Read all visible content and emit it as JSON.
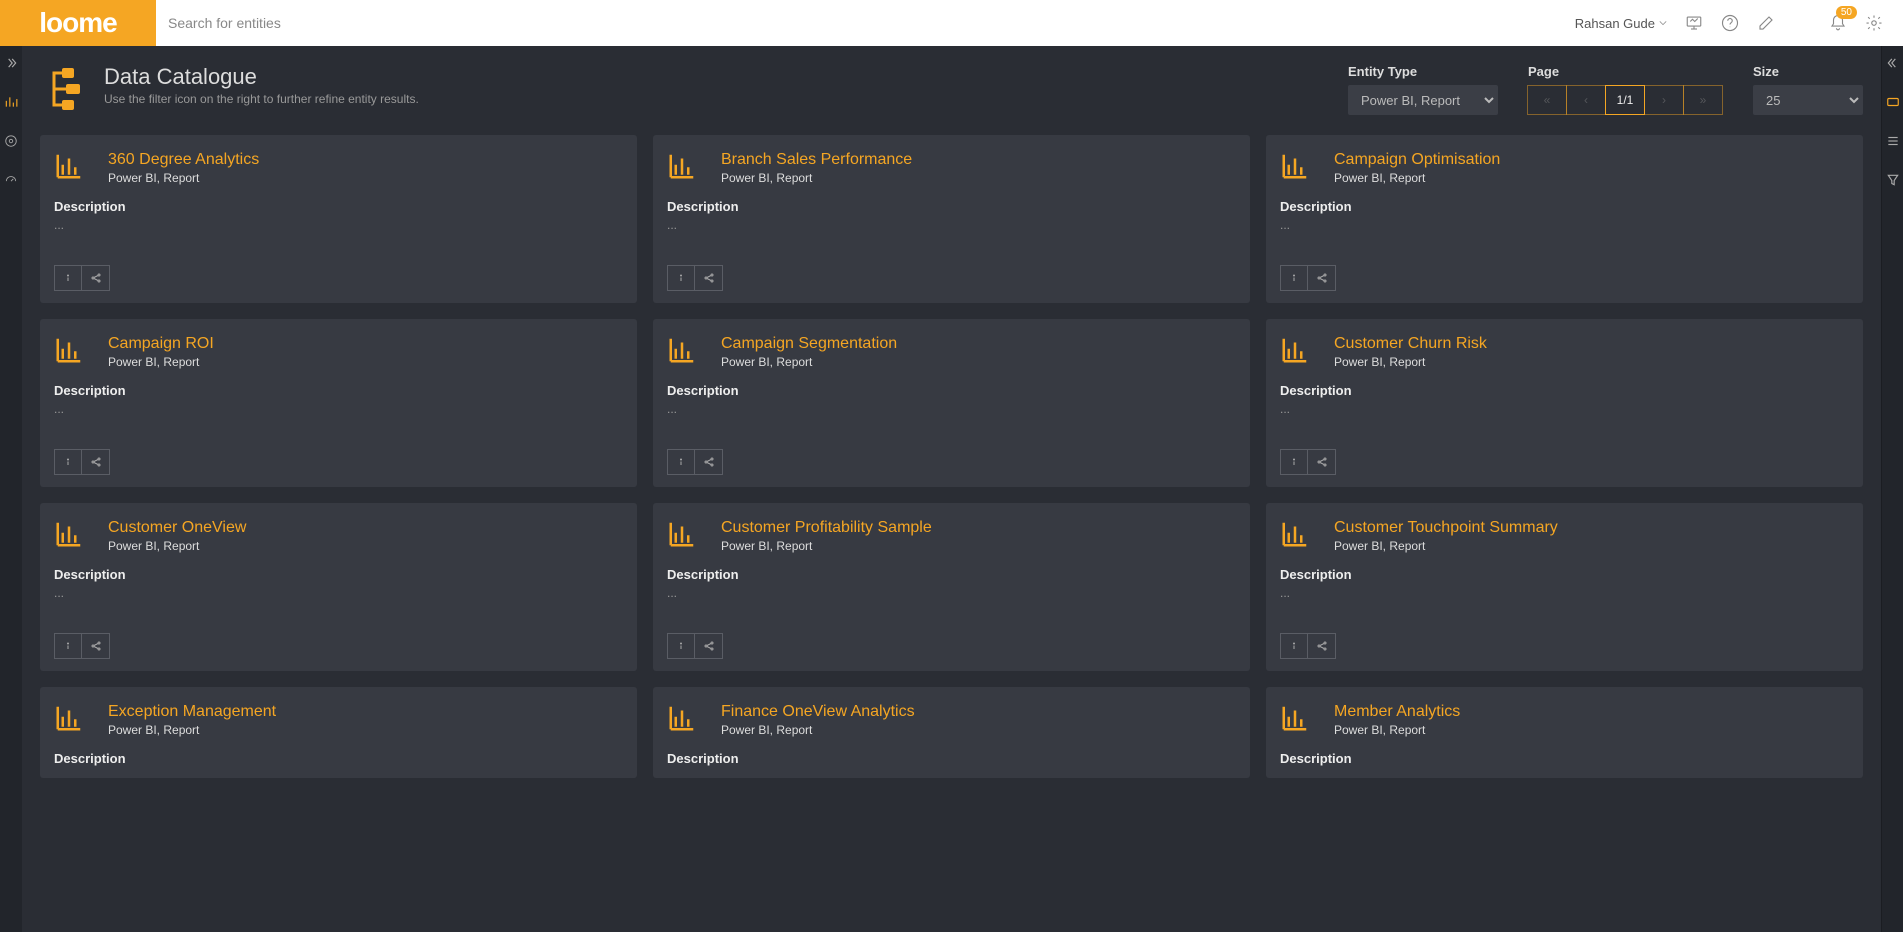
{
  "topbar": {
    "logo": "loome",
    "search_placeholder": "Search for entities",
    "username": "Rahsan Gude",
    "notification_count": "50"
  },
  "page": {
    "title": "Data Catalogue",
    "subtitle": "Use the filter icon on the right to further refine entity results."
  },
  "controls": {
    "entity_type_label": "Entity Type",
    "entity_type_value": "Power BI, Report",
    "page_label": "Page",
    "page_current": "1/1",
    "size_label": "Size",
    "size_value": "25"
  },
  "card_type": "Power BI, Report",
  "desc_label": "Description",
  "desc_placeholder": "...",
  "cards": [
    {
      "title": "360 Degree Analytics"
    },
    {
      "title": "Branch Sales Performance"
    },
    {
      "title": "Campaign Optimisation"
    },
    {
      "title": "Campaign ROI"
    },
    {
      "title": "Campaign Segmentation"
    },
    {
      "title": "Customer Churn Risk"
    },
    {
      "title": "Customer OneView"
    },
    {
      "title": "Customer Profitability Sample"
    },
    {
      "title": "Customer Touchpoint Summary"
    },
    {
      "title": "Exception Management"
    },
    {
      "title": "Finance OneView Analytics"
    },
    {
      "title": "Member Analytics"
    }
  ]
}
